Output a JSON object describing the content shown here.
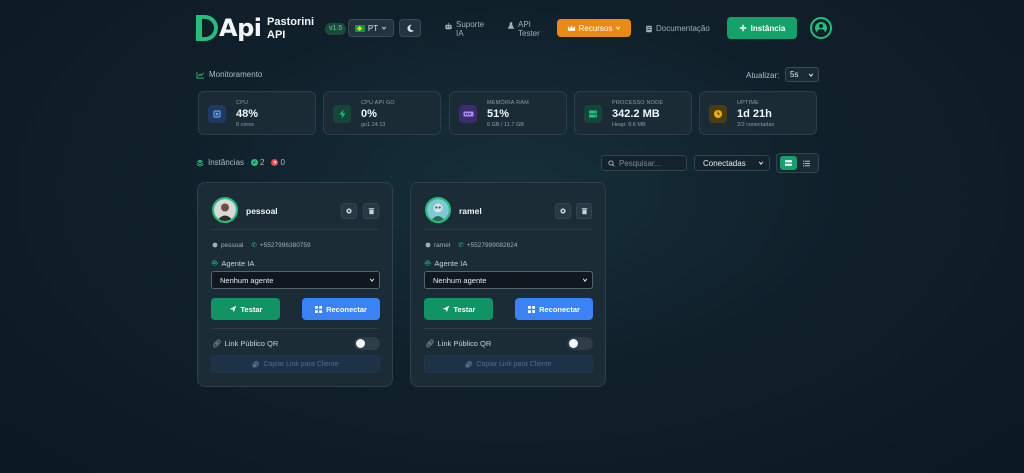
{
  "header": {
    "logo_text": "Api",
    "brand_line1": "Pastorini",
    "brand_line2": "API",
    "version": "v1.5",
    "language": "PT",
    "nav": {
      "suporte_line1": "Suporte",
      "suporte_line2": "IA",
      "apitester_line1": "API",
      "apitester_line2": "Tester",
      "recursos": "Recursos",
      "documentacao": "Documentação",
      "new_instance": "Instância"
    }
  },
  "monitor": {
    "title": "Monitoramento",
    "refresh_label": "Atualizar:",
    "refresh_value": "5s",
    "stats": [
      {
        "label": "CPU",
        "value": "48%",
        "sub": "8 cores",
        "icon": "cpu-icon",
        "color": "#3b82f6"
      },
      {
        "label": "CPU API GO",
        "value": "0%",
        "sub": "go1.24.13",
        "icon": "bolt-icon",
        "color": "#22c07a"
      },
      {
        "label": "MEMÓRIA RAM",
        "value": "51%",
        "sub": "6 GB / 11.7 GB",
        "icon": "memory-icon",
        "color": "#8b5cf6"
      },
      {
        "label": "PROCESSO NODE",
        "value": "342.2 MB",
        "sub": "Heap: 8.6 MB",
        "icon": "server-icon",
        "color": "#22c07a"
      },
      {
        "label": "UPTIME",
        "value": "1d 21h",
        "sub": "2/2 conectadas",
        "icon": "clock-icon",
        "color": "#eab308"
      }
    ]
  },
  "instances_bar": {
    "title": "Instâncias",
    "connected_count": "2",
    "disconnected_count": "0",
    "search_placeholder": "Pesquisar...",
    "filter_value": "Conectadas"
  },
  "cards": [
    {
      "name": "pessoal",
      "meta_name": "pessoal",
      "phone": "+5527996380759",
      "agent_label": "Agente IA",
      "agent_select": "Nenhum agente",
      "test_label": "Testar",
      "reconnect_label": "Reconectar",
      "qr_label": "Link Público QR",
      "copy_label": "Copiar Link para Cliente"
    },
    {
      "name": "ramel",
      "meta_name": "ramel",
      "phone": "+5527999082624",
      "agent_label": "Agente IA",
      "agent_select": "Nenhum agente",
      "test_label": "Testar",
      "reconnect_label": "Reconectar",
      "qr_label": "Link Público QR",
      "copy_label": "Copiar Link para Cliente"
    }
  ],
  "colors": {
    "accent": "#14a26a",
    "warning": "#e98b12",
    "primary": "#3b82f6",
    "danger": "#ef4444"
  }
}
